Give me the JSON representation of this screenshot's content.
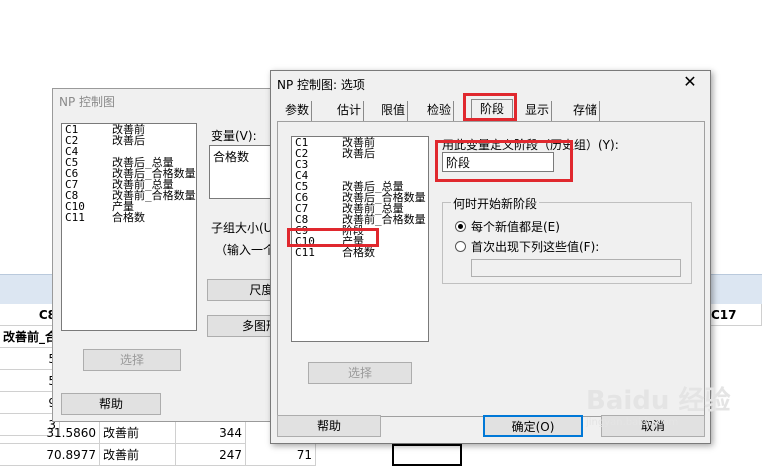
{
  "worksheet": {
    "header_left": "C8",
    "header_right": "C17",
    "col_name_left": "改善前_合",
    "rows": [
      {
        "a": "5",
        "b": "",
        "c": "",
        "d": ""
      },
      {
        "a": "5",
        "b": "",
        "c": "",
        "d": ""
      },
      {
        "a": "9",
        "b": "",
        "c": "",
        "d": ""
      },
      {
        "a": "3",
        "b": "",
        "c": "",
        "d": ""
      },
      {
        "a": "31.5860",
        "b": "改善前",
        "c": "344",
        "d": ""
      },
      {
        "a": "70.8977",
        "b": "改善前",
        "c": "247",
        "d": "71"
      }
    ]
  },
  "back_dialog": {
    "title": "NP 控制图",
    "list": [
      {
        "code": "C1",
        "name": "改善前"
      },
      {
        "code": "C2",
        "name": "改善后"
      },
      {
        "code": "C4",
        "name": ""
      },
      {
        "code": "C5",
        "name": "改善后_总量"
      },
      {
        "code": "C6",
        "name": "改善后_合格数量"
      },
      {
        "code": "C7",
        "name": "改善前_总量"
      },
      {
        "code": "C8",
        "name": "改善前_合格数量"
      },
      {
        "code": "C10",
        "name": "产量"
      },
      {
        "code": "C11",
        "name": "合格数"
      }
    ],
    "variable_label": "变量(V):",
    "variable_value": "合格数",
    "subgroup_label": "子组大小(U",
    "hint_text": "（输入一个",
    "scale_button": "尺度(",
    "multi_button": "多图形",
    "select_button": "选择",
    "help_button": "帮助"
  },
  "front_dialog": {
    "title": "NP 控制图: 选项",
    "close_glyph": "✕",
    "tabs": [
      "参数",
      "估计",
      "限值",
      "检验",
      "阶段",
      "显示",
      "存储"
    ],
    "active_tab": "阶段",
    "list": [
      {
        "code": "C1",
        "name": "改善前"
      },
      {
        "code": "C2",
        "name": "改善后"
      },
      {
        "code": "C3",
        "name": ""
      },
      {
        "code": "C4",
        "name": ""
      },
      {
        "code": "C5",
        "name": "改善后_总量"
      },
      {
        "code": "C6",
        "name": "改善后_合格数量"
      },
      {
        "code": "C7",
        "name": "改善前_总量"
      },
      {
        "code": "C8",
        "name": "改善前_合格数量"
      },
      {
        "code": "C9",
        "name": "阶段"
      },
      {
        "code": "C10",
        "name": "产量"
      },
      {
        "code": "C11",
        "name": "合格数"
      }
    ],
    "define_label": "用此变量定义阶段（历史组）(Y):",
    "define_value": "阶段",
    "group_title": "何时开始新阶段",
    "radio_each": "每个新值都是(E)",
    "radio_first": "首次出现下列这些值(F):",
    "first_values": "",
    "select_button": "选择",
    "help_button": "帮助",
    "ok_button": "确定(O)",
    "cancel_button": "取消"
  },
  "watermark": {
    "text": "Baidu 经验",
    "sub": "jingyan.baidu.com"
  },
  "colors": {
    "highlight": "#e0282e",
    "header_band": "#dce6f2"
  }
}
